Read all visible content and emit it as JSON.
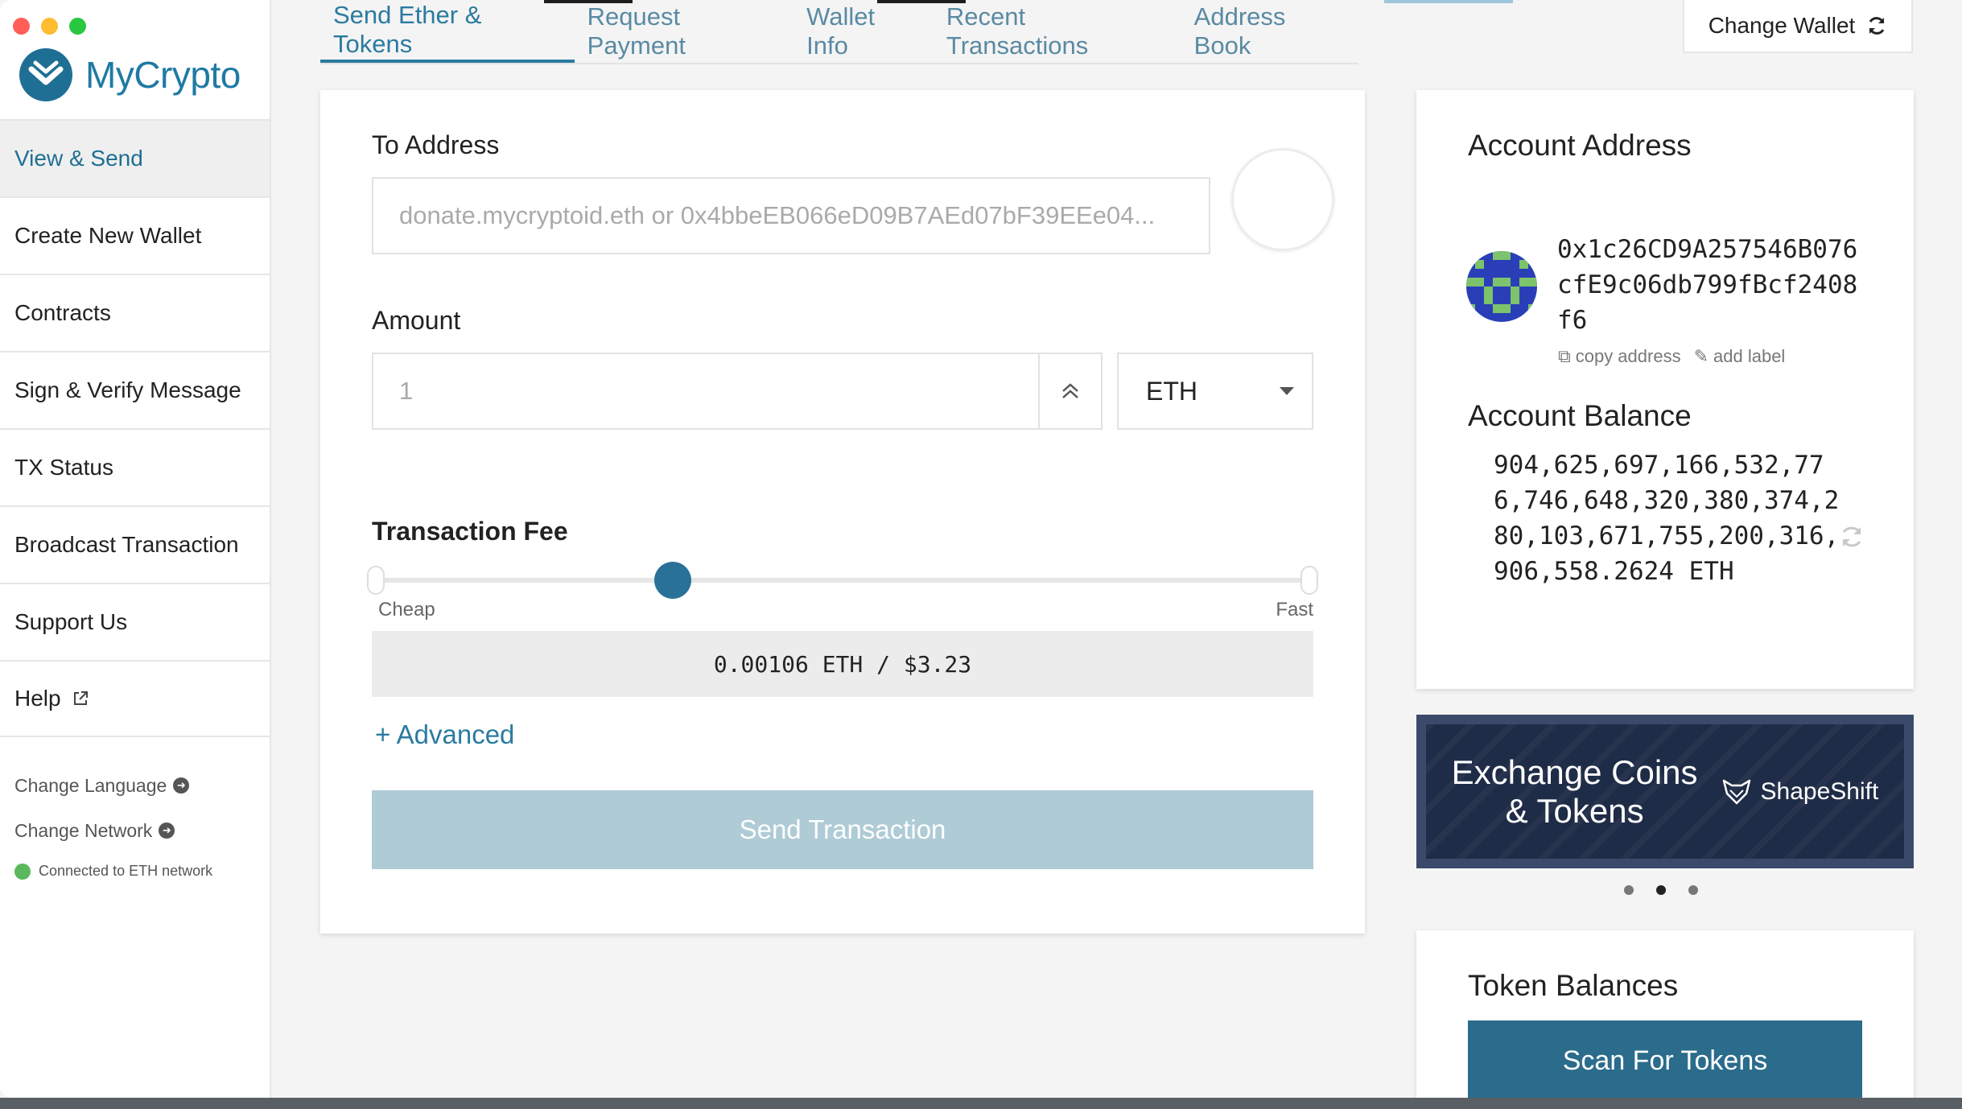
{
  "app": {
    "name": "MyCrypto"
  },
  "sidebar": {
    "items": [
      {
        "label": "View & Send",
        "active": true
      },
      {
        "label": "Create New Wallet"
      },
      {
        "label": "Contracts"
      },
      {
        "label": "Sign & Verify Message"
      },
      {
        "label": "TX Status"
      },
      {
        "label": "Broadcast Transaction"
      },
      {
        "label": "Support Us"
      },
      {
        "label": "Help",
        "icon": "external-link-icon"
      }
    ],
    "change_language": "Change Language",
    "change_network": "Change Network",
    "network_status": "Connected to ETH network"
  },
  "tabs": [
    {
      "label": "Send Ether & Tokens",
      "active": true
    },
    {
      "label": "Request Payment"
    },
    {
      "label": "Wallet Info"
    },
    {
      "label": "Recent Transactions"
    },
    {
      "label": "Address Book"
    }
  ],
  "header": {
    "change_wallet": "Change Wallet"
  },
  "send": {
    "to_label": "To Address",
    "to_placeholder": "donate.mycryptoid.eth or 0x4bbeEB066eD09B7AEd07bF39EEe04...",
    "amount_label": "Amount",
    "amount_placeholder": "1",
    "unit": "ETH",
    "fee_label": "Transaction Fee",
    "fee_slider_fraction": 0.32,
    "cheap": "Cheap",
    "fast": "Fast",
    "fee_value": "0.00106 ETH / $3.23",
    "advanced": "+ Advanced",
    "send_button": "Send Transaction"
  },
  "account": {
    "address_title": "Account Address",
    "address": "0x1c26CD9A257546B076cfE9c06db799fBcf2408f6",
    "copy_address": "copy address",
    "add_label": "add label",
    "balance_title": "Account Balance",
    "balance": "904,625,697,166,532,776,746,648,320,380,374,280,103,671,755,200,316,906,558.2624 ETH"
  },
  "banner": {
    "title_line1": "Exchange Coins",
    "title_line2": "& Tokens",
    "brand": "ShapeShift"
  },
  "tokens": {
    "title": "Token Balances",
    "scan_button": "Scan For Tokens"
  },
  "colors": {
    "accent": "#2b7ba0",
    "send_button_disabled": "#aecbd6",
    "banner_bg": "#1f2c47",
    "status_green": "#5cb85c"
  }
}
